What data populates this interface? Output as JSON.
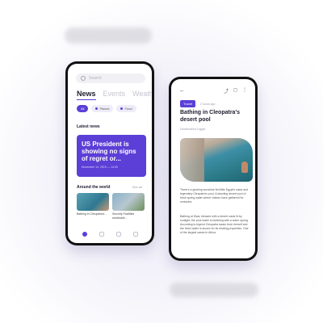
{
  "phone1": {
    "search_placeholder": "Search",
    "tabs": [
      "News",
      "Events",
      "Weather"
    ],
    "chips": [
      "All",
      "Places",
      "Food"
    ],
    "latest_news_title": "Latest news",
    "hero": {
      "title": "US President is showing no signs of regret or...",
      "date": "November 14, 2019 — 14:30"
    },
    "around_title": "Around the world",
    "see_all": "See all",
    "cards": [
      {
        "caption": "Bathing in Cleopatra's..."
      },
      {
        "caption": "Security Facilities worldwide..."
      }
    ]
  },
  "phone2": {
    "back_label": "←",
    "actions": [
      "⤴",
      "◻",
      "⋮"
    ],
    "tag": "Travel",
    "time": "2 hours ago",
    "title": "Bathing in Cleopatra's desert pool",
    "subtitle": "Destination Egypt",
    "paragraph1": "There's a gushing sunshine fed little Egypt's oasis and legendary Cleopatra's pool. A dazzling desert pool of fresh spring water where visitors have gathered for centuries.",
    "paragraph2": "Bathing at Siwa, blessed with a desert oasis lit by sunlight, the pool water is bubbling with a warm spring. According to legend Cleopatra swam here herself and the fresh water is known for its healing properties. One of the largest oases in Africa."
  },
  "colors": {
    "accent": "#5b3fd6"
  }
}
